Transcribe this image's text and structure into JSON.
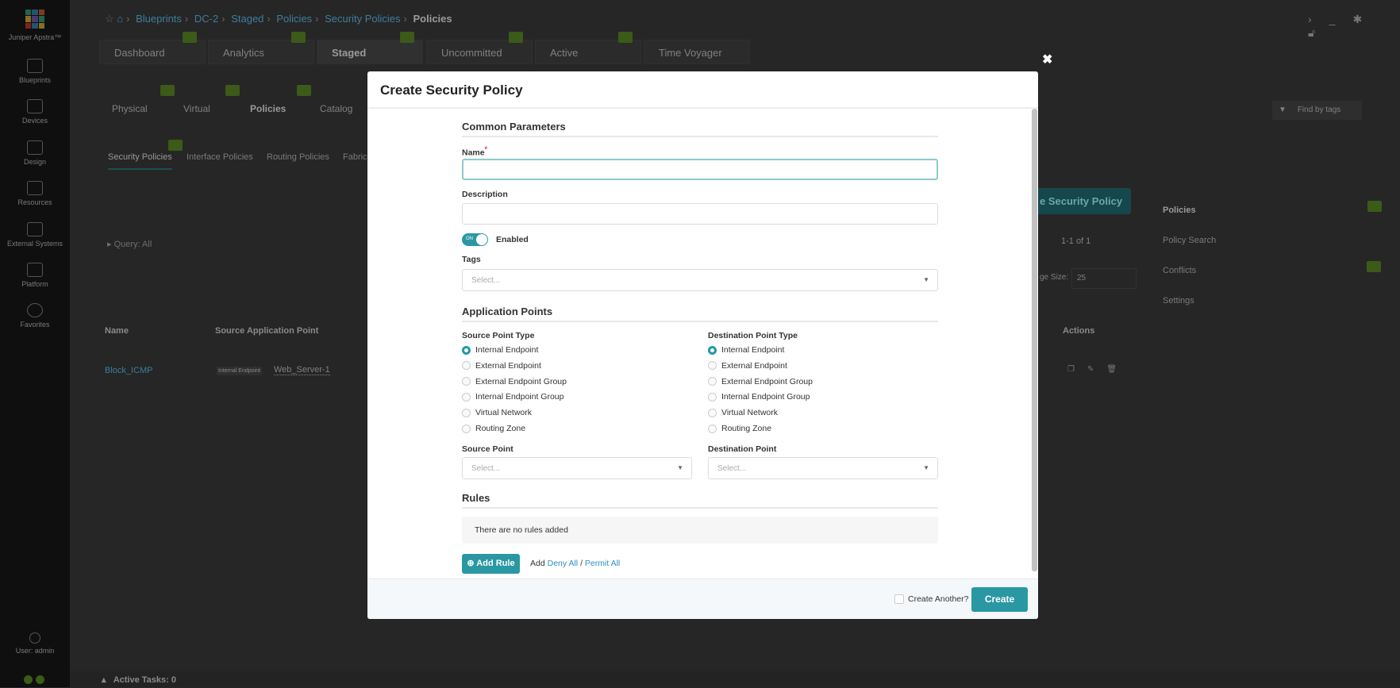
{
  "app": {
    "brand": "Juniper Apstra™"
  },
  "sidebar": {
    "items": [
      {
        "label": "Blueprints"
      },
      {
        "label": "Devices"
      },
      {
        "label": "Design"
      },
      {
        "label": "Resources"
      },
      {
        "label": "External Systems"
      },
      {
        "label": "Platform"
      },
      {
        "label": "Favorites"
      }
    ],
    "user": "User: admin"
  },
  "breadcrumb": [
    "Blueprints",
    "DC-2",
    "Staged",
    "Policies",
    "Security Policies",
    "Policies"
  ],
  "tabs": [
    "Dashboard",
    "Analytics",
    "Staged",
    "Uncommitted",
    "Active",
    "Time Voyager"
  ],
  "subtabs": [
    "Physical",
    "Virtual",
    "Policies",
    "Catalog"
  ],
  "policytabs": [
    "Security Policies",
    "Interface Policies",
    "Routing Policies",
    "Fabric"
  ],
  "find_by_tags": "Find by tags",
  "query": "Query: All",
  "create_policy_btn": "e Security Policy",
  "pagination": "1-1 of 1",
  "page_size_label": "ge Size:",
  "page_size": "25",
  "table": {
    "headers": [
      "Name",
      "Source Application Point",
      "Actions"
    ],
    "rows": [
      {
        "name": "Block_ICMP",
        "src_type": "Internal Endpoint",
        "src": "Web_Server-1"
      }
    ]
  },
  "right_menu": [
    "Policies",
    "Policy Search",
    "Conflicts",
    "Settings"
  ],
  "active_tasks": "Active Tasks: 0",
  "modal": {
    "title": "Create Security Policy",
    "common": "Common Parameters",
    "name_label": "Name",
    "required": "*",
    "name_value": "",
    "desc_label": "Description",
    "toggle_state": "ON",
    "enabled_label": "Enabled",
    "tags_label": "Tags",
    "select_placeholder": "Select...",
    "app_points": "Application Points",
    "src_type_label": "Source Point Type",
    "dst_type_label": "Destination Point Type",
    "point_types": [
      "Internal Endpoint",
      "External Endpoint",
      "External Endpoint Group",
      "Internal Endpoint Group",
      "Virtual Network",
      "Routing Zone"
    ],
    "src_selected": "Internal Endpoint",
    "dst_selected": "Internal Endpoint",
    "src_point_label": "Source Point",
    "dst_point_label": "Destination Point",
    "rules": "Rules",
    "no_rules": "There are no rules added",
    "add_rule": "Add Rule",
    "add": "Add",
    "deny_all": "Deny All",
    "slash": "/",
    "permit_all": "Permit All",
    "create_another": "Create Another?",
    "create": "Create"
  },
  "colors": {
    "accent": "#2a98a3",
    "badge": "#7fbf2a"
  }
}
